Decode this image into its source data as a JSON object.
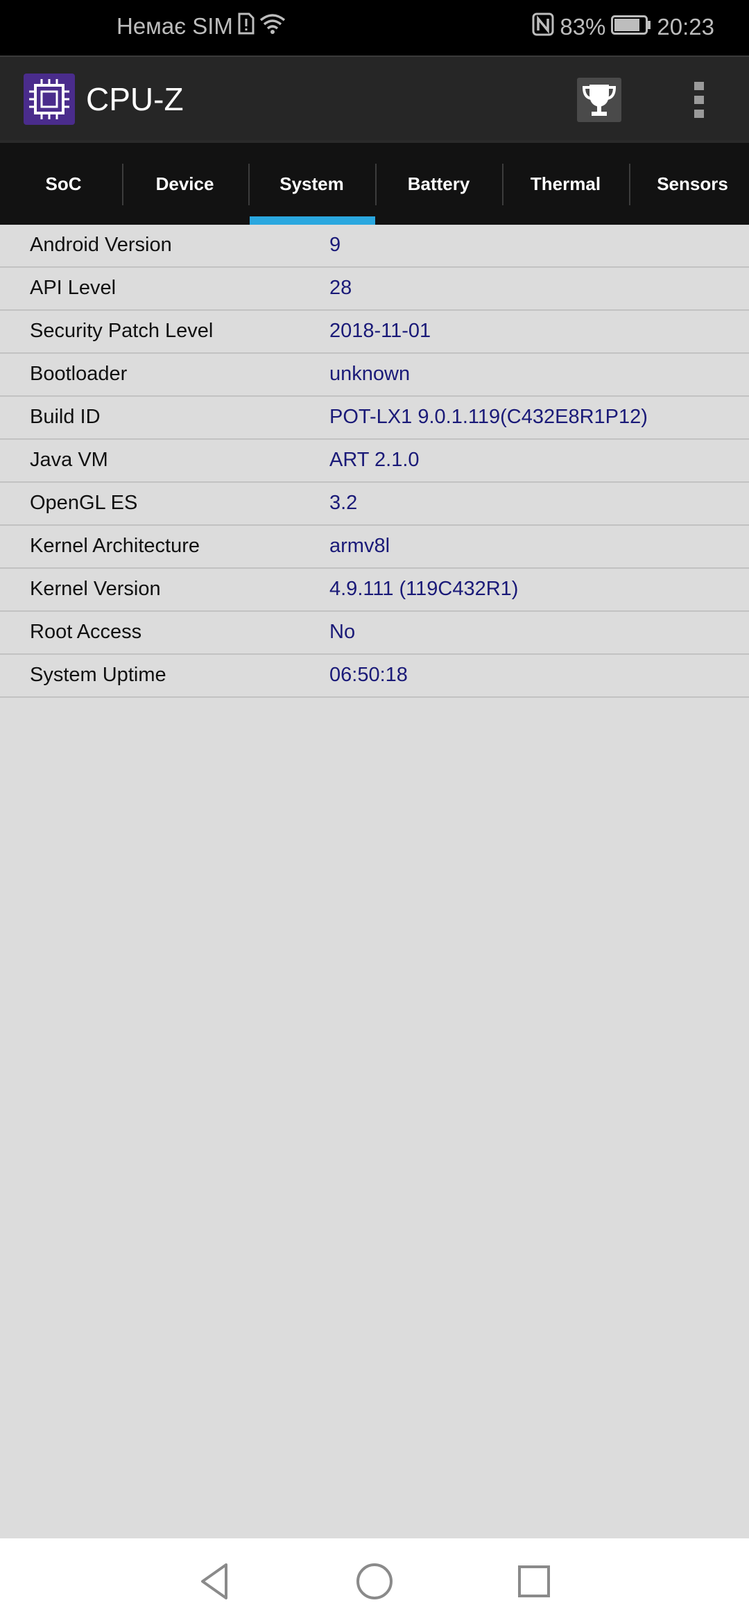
{
  "status_bar": {
    "carrier": "Немає SIM",
    "battery_percent": "83%",
    "time": "20:23",
    "battery_level": 0.83
  },
  "app_bar": {
    "title": "CPU-Z",
    "icons": [
      "cpu-chip-icon",
      "trophy-icon",
      "more-vert-icon"
    ]
  },
  "tabs": [
    {
      "label": "SoC",
      "active": false
    },
    {
      "label": "Device",
      "active": false
    },
    {
      "label": "System",
      "active": true
    },
    {
      "label": "Battery",
      "active": false
    },
    {
      "label": "Thermal",
      "active": false
    },
    {
      "label": "Sensors",
      "active": false
    }
  ],
  "system_info": [
    {
      "label": "Android Version",
      "value": "9"
    },
    {
      "label": "API Level",
      "value": "28"
    },
    {
      "label": "Security Patch Level",
      "value": "2018-11-01"
    },
    {
      "label": "Bootloader",
      "value": "unknown"
    },
    {
      "label": "Build ID",
      "value": "POT-LX1 9.0.1.119(C432E8R1P12)"
    },
    {
      "label": "Java VM",
      "value": "ART 2.1.0"
    },
    {
      "label": "OpenGL ES",
      "value": "3.2"
    },
    {
      "label": "Kernel Architecture",
      "value": "armv8l"
    },
    {
      "label": "Kernel Version",
      "value": "4.9.111 (119C432R1)"
    },
    {
      "label": "Root Access",
      "value": "No"
    },
    {
      "label": "System Uptime",
      "value": "06:50:18"
    }
  ],
  "colors": {
    "accent": "#2aa7df",
    "value_text": "#1a1a78",
    "background": "#dcdcdc"
  },
  "nav_bar": [
    "back-icon",
    "home-icon",
    "recents-icon"
  ]
}
